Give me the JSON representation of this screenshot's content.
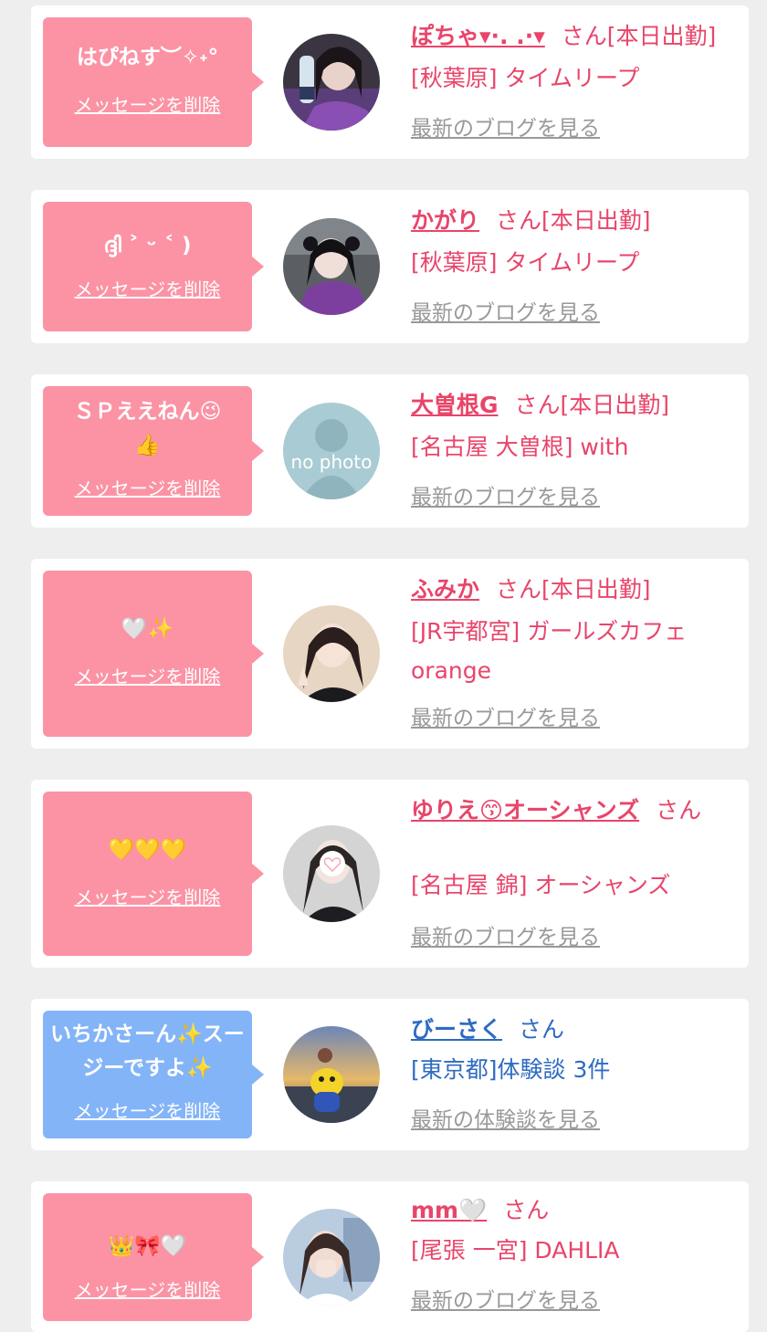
{
  "colors": {
    "pink_bubble": "#fb93a5",
    "blue_bubble": "#83b4f7",
    "pink_text": "#e8456a",
    "blue_text": "#2e6bc2",
    "link_gray": "#999999"
  },
  "cards": [
    {
      "message": "はぴねす︶✧˖°",
      "delete_label": "メッセージを削除",
      "name": "ぽちゃ▾·. .·▾",
      "honorific": "さん[本日出勤]",
      "shop": "[秋葉原] タイムリープ",
      "latest_link": "最新のブログを見る"
    },
    {
      "message": "ദ്ദി ˃ ᵕ ˂ )",
      "delete_label": "メッセージを削除",
      "name": "かがり",
      "honorific": "さん[本日出勤]",
      "shop": "[秋葉原] タイムリープ",
      "latest_link": "最新のブログを見る"
    },
    {
      "message": "ＳＰええねん😉\n👍",
      "delete_label": "メッセージを削除",
      "name": "大曽根G",
      "honorific": "さん[本日出勤]",
      "shop": "[名古屋 大曽根] with",
      "latest_link": "最新のブログを見る",
      "avatar_caption": "no photo"
    },
    {
      "message": "🤍✨",
      "delete_label": "メッセージを削除",
      "name": "ふみか",
      "honorific": "さん[本日出勤]",
      "shop": "[JR宇都宮] ガールズカフェ orange",
      "latest_link": "最新のブログを見る"
    },
    {
      "message": "💛💛💛",
      "delete_label": "メッセージを削除",
      "name": "ゆりえ😙オーシャンズ",
      "honorific": "さん",
      "shop": "[名古屋 錦] オーシャンズ",
      "latest_link": "最新のブログを見る"
    },
    {
      "message": "いちかさーん✨スージーですよ✨",
      "delete_label": "メッセージを削除",
      "name": "びーさく",
      "honorific": "さん",
      "shop": "[東京都]体験談 3件",
      "latest_link": "最新の体験談を見る"
    },
    {
      "message": "👑🎀🤍",
      "delete_label": "メッセージを削除",
      "name": "mm🤍",
      "honorific": "さん",
      "shop": "[尾張 一宮] DAHLIA",
      "latest_link": "最新のブログを見る"
    }
  ]
}
